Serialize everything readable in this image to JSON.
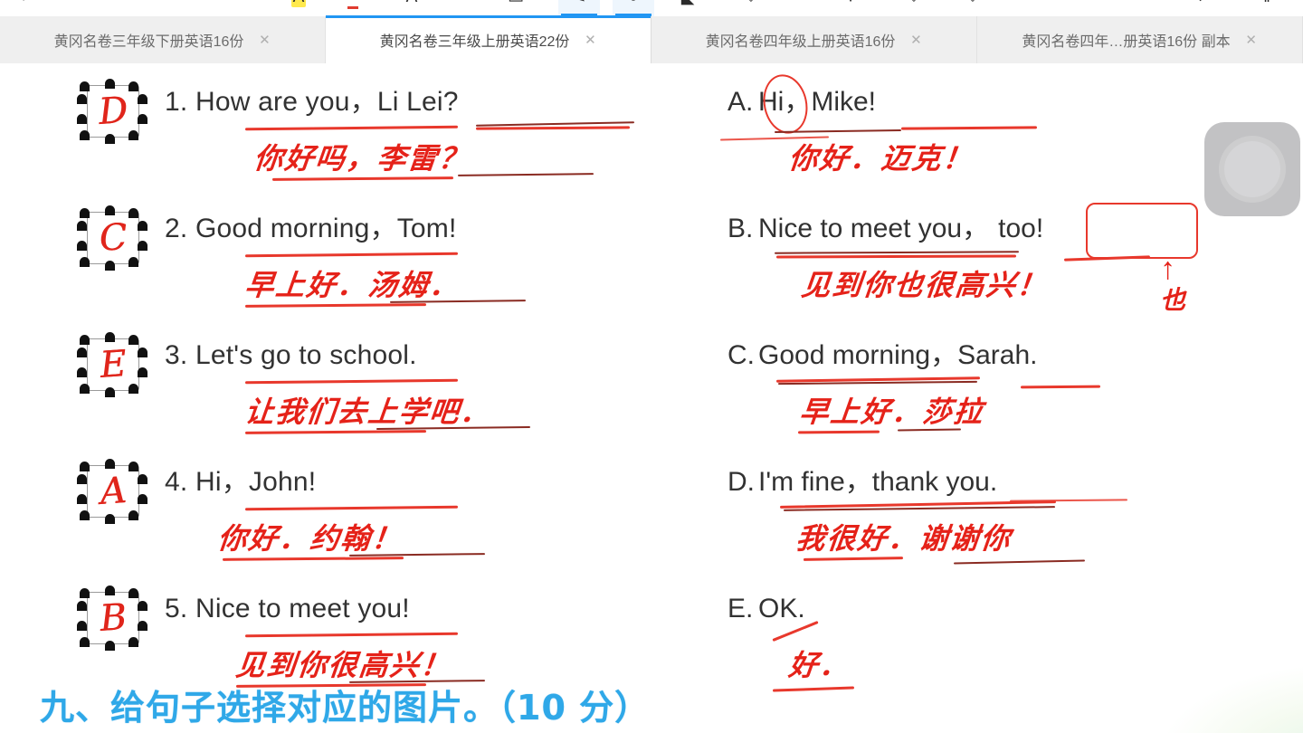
{
  "toolbar": {
    "icons": [
      {
        "name": "dashed-select-icon",
        "glyph": "⌐",
        "selected": false
      },
      {
        "name": "highlight-a-icon",
        "glyph": "A",
        "selected": false,
        "style": "highlight"
      },
      {
        "name": "underline-a-icon",
        "glyph": "A",
        "selected": false,
        "style": "underline"
      },
      {
        "name": "text-a-icon",
        "glyph": "A",
        "selected": false
      },
      {
        "name": "note-page-icon",
        "glyph": "▭",
        "selected": false
      },
      {
        "name": "pen-icon",
        "glyph": "✎",
        "selected": true
      },
      {
        "name": "red-stamp-icon",
        "glyph": "●",
        "selected": true
      },
      {
        "name": "eraser-icon",
        "glyph": "◣",
        "selected": false
      },
      {
        "name": "marker-tip-icon",
        "glyph": "⌵",
        "selected": false
      },
      {
        "name": "yellow-highlighter-icon",
        "glyph": "▼",
        "selected": false
      },
      {
        "name": "pen-tip-outline-icon",
        "glyph": "⌵",
        "selected": false
      },
      {
        "name": "pen-tip-outline2-icon",
        "glyph": "⌵",
        "selected": false
      },
      {
        "name": "undo-arrow-icon",
        "glyph": "↩",
        "selected": false
      },
      {
        "name": "pause-icon",
        "glyph": "‖",
        "selected": false
      }
    ]
  },
  "tabs": [
    {
      "label": "黄冈名卷三年级下册英语16份",
      "close": "✕",
      "active": false
    },
    {
      "label": "黄冈名卷三年级上册英语22份",
      "close": "✕",
      "active": true
    },
    {
      "label": "黄冈名卷四年级上册英语16份",
      "close": "✕",
      "active": false
    },
    {
      "label": "黄冈名卷四年…册英语16份 副本",
      "close": "✕",
      "active": false
    }
  ],
  "worksheet": {
    "questions": [
      {
        "answer": "D",
        "number": "1.",
        "english": "How are you，Li Lei?",
        "chinese": "你好吗，李雷？"
      },
      {
        "answer": "C",
        "number": "2.",
        "english": "Good morning，Tom!",
        "chinese": "早上好．汤姆．"
      },
      {
        "answer": "E",
        "number": "3.",
        "english": "Let's go to school.",
        "chinese": "让我们去上学吧．"
      },
      {
        "answer": "A",
        "number": "4.",
        "english": "Hi，John!",
        "chinese": "你好．约翰！"
      },
      {
        "answer": "B",
        "number": "5.",
        "english": "Nice to meet you!",
        "chinese": "见到你很高兴！"
      }
    ],
    "options": [
      {
        "letter": "A.",
        "english": "Hi，Mike!",
        "chinese": "你好．迈克！"
      },
      {
        "letter": "B.",
        "english": "Nice to meet you，",
        "english_boxed": "too!",
        "chinese": "见到你也很高兴！",
        "annotation": "也"
      },
      {
        "letter": "C.",
        "english": "Good morning，Sarah.",
        "chinese": "早上好．莎拉"
      },
      {
        "letter": "D.",
        "english": "I'm fine，thank you.",
        "chinese": "我很好．谢谢你"
      },
      {
        "letter": "E.",
        "english": "OK.",
        "chinese": "好．"
      }
    ],
    "section_heading": "九、给句子选择对应的图片。（10 分）"
  },
  "colors": {
    "ink_red": "#e52219",
    "stroke_red": "#e8382c",
    "heading_blue": "#2fa8e8",
    "text_black": "#323232",
    "tab_active_accent": "#2196f3"
  },
  "assistive": {
    "name": "assistive-touch-button"
  }
}
